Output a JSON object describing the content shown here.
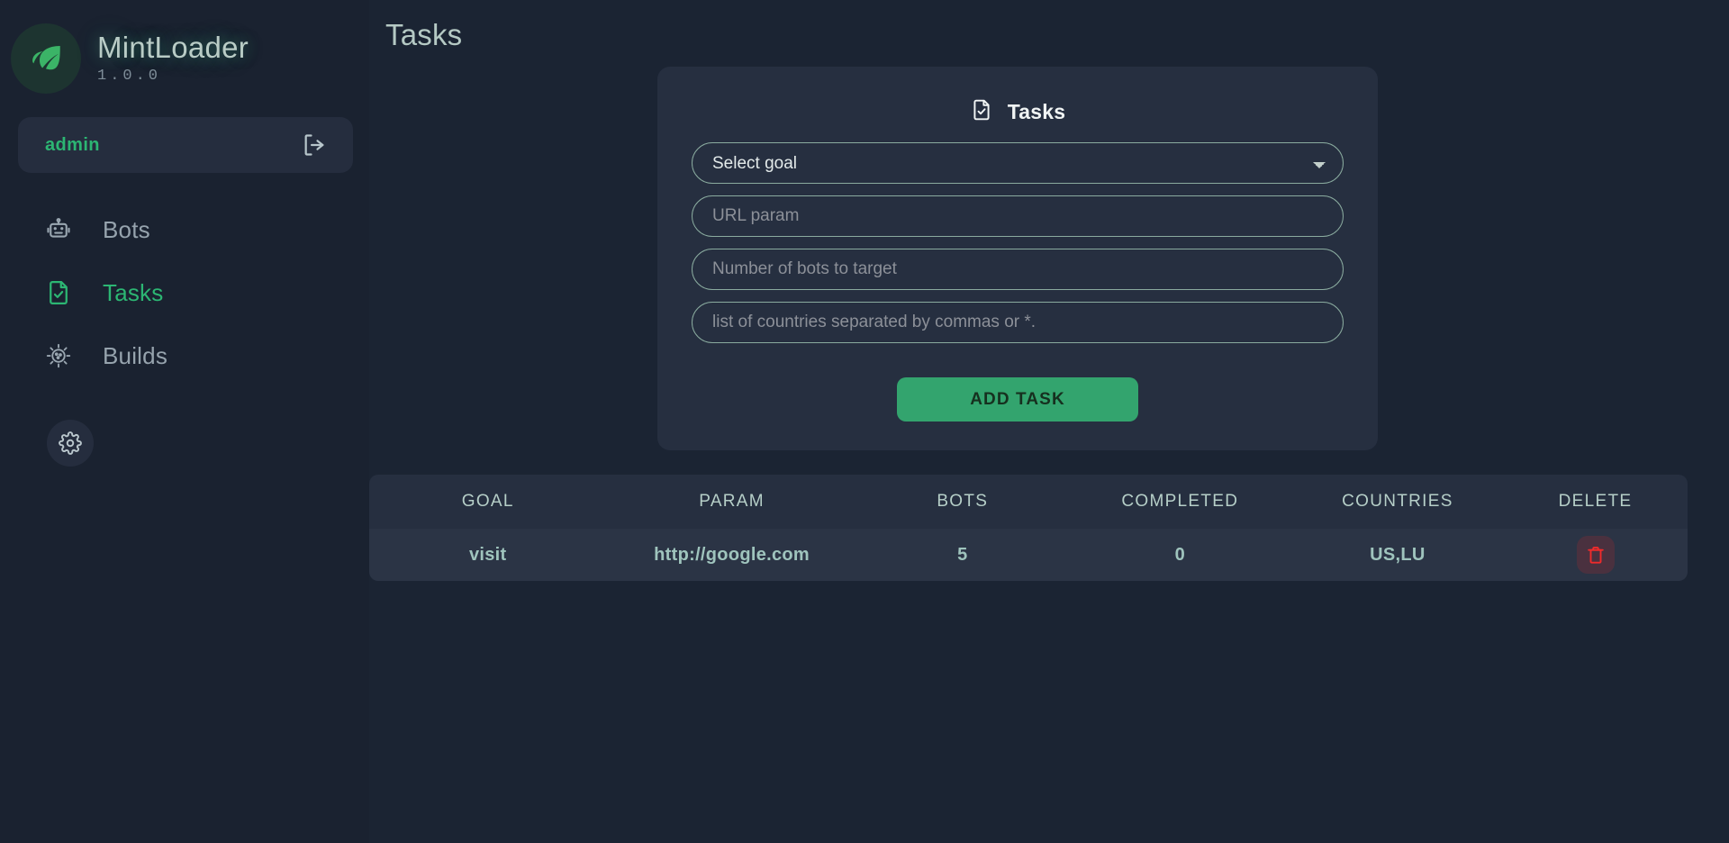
{
  "brand": {
    "name": "MintLoader",
    "version": "1.0.0",
    "logo_icon": "mint-leaf-icon"
  },
  "user": {
    "name": "admin",
    "logout_icon": "logout-icon"
  },
  "sidebar": {
    "items": [
      {
        "label": "Bots",
        "icon": "robot-icon",
        "active": false
      },
      {
        "label": "Tasks",
        "icon": "document-check-icon",
        "active": true
      },
      {
        "label": "Builds",
        "icon": "virus-gear-icon",
        "active": false
      }
    ],
    "settings_icon": "gear-icon"
  },
  "header": {
    "title": "Tasks"
  },
  "card": {
    "title": "Tasks",
    "icon": "document-check-icon",
    "form": {
      "goal_select": {
        "value": "Select goal",
        "options": [
          "Select goal"
        ]
      },
      "url_param": {
        "value": "",
        "placeholder": "URL param"
      },
      "bots_count": {
        "value": "",
        "placeholder": "Number of bots to target"
      },
      "countries": {
        "value": "",
        "placeholder": "list of countries separated by commas or *."
      },
      "submit_label": "ADD TASK"
    }
  },
  "table": {
    "columns": [
      "GOAL",
      "PARAM",
      "BOTS",
      "COMPLETED",
      "COUNTRIES",
      "DELETE"
    ],
    "rows": [
      {
        "goal": "visit",
        "param": "http://google.com",
        "bots": "5",
        "completed": "0",
        "countries": "US,LU",
        "delete_icon": "trash-icon"
      }
    ]
  },
  "colors": {
    "accent_green": "#2cb673",
    "button_green": "#33a46e",
    "page_bg": "#1b2433",
    "sidebar_bg": "#1a2230",
    "card_bg": "#262f40",
    "row_bg": "#2b3445",
    "danger_red": "#ef2b2b",
    "muted_text": "#96a3ad",
    "table_text": "#9fc4bd"
  }
}
